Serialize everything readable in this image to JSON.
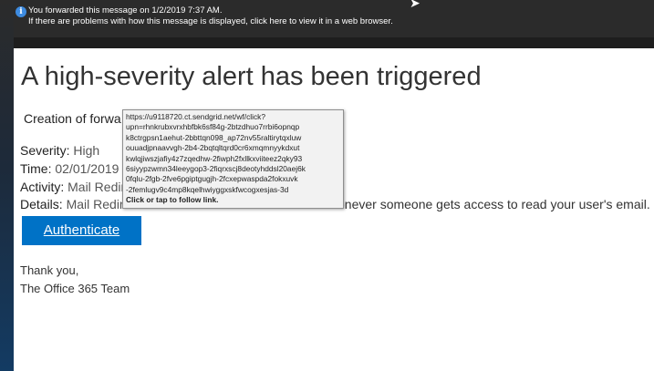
{
  "info_bar": {
    "line1": "You forwarded this message on 1/2/2019 7:37 AM.",
    "line2": "If there are problems with how this message is displayed, click here to view it in a web browser.",
    "icon": "info-icon"
  },
  "email": {
    "headline": "A high-severity alert has been triggered",
    "intro": "Creation of forwa",
    "severity": {
      "label": "Severity:",
      "value": "High"
    },
    "time": {
      "label": "Time:",
      "value": "02/01/2019 7"
    },
    "activity": {
      "label": "Activity:",
      "value": "Mail Redire"
    },
    "details": {
      "label": "Details:",
      "value": "Mail Redire",
      "tail": "enever someone gets access to read your user's email."
    },
    "button_label": "Authenticate",
    "button_color": "#0072c6",
    "thanks": "Thank you,",
    "signature": "The Office 365 Team"
  },
  "tooltip": {
    "url": "https://u9118720.ct.sendgrid.net/wf/click?\nupn=rhnkrubxvrxhbfbk6sf84g-2btzdhuo7rrbi6opnqp\nk8ctrgpsn1aehut-2bbttqn098_ap72nv55raltirytqxluw\nouuadjpnaavvgh-2b4-2bqtqltqrd0cr6xmqmnyykdxut\nkwlqjiwszjafiy4z7zqedhw-2fiwph2fxllkxviiteez2qky93\n6siyypzwmn34leeygop3-2fiqrxscj8deotyhddsl20aej6k\n0fqlu-2fgb-2fve6pgiptgugjh-2fcxepwaspda2fokxuvk\n-2femlugv9c4mp8kqelhwiyggxskfwcogxesjas-3d",
    "hint": "Click or tap to follow link."
  }
}
